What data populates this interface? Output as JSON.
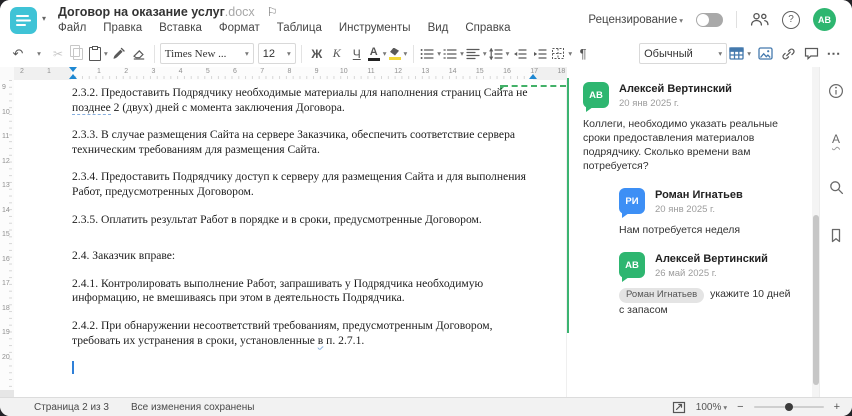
{
  "window": {
    "title": "Договор на оказание услуг",
    "ext": ".docx"
  },
  "menu": {
    "items": [
      "Файл",
      "Правка",
      "Вставка",
      "Формат",
      "Таблица",
      "Инструменты",
      "Вид",
      "Справка"
    ]
  },
  "topbar": {
    "review_label": "Рецензирование",
    "avatar_initials": "АВ"
  },
  "toolbar": {
    "font_name": "Times New ...",
    "font_size": "12",
    "bold_label": "Ж",
    "italic_label": "К",
    "underline_label": "Ч",
    "font_color_letter": "А",
    "style_name": "Обычный"
  },
  "icons": {
    "undo": "↶",
    "caret": "▾",
    "cut": "✂",
    "pilcrow": "¶",
    "more": "⋯",
    "flag": "⚐",
    "question": "?",
    "minus": "−",
    "plus": "+",
    "spell_letter": "А"
  },
  "ruler": {
    "h_left": [
      "2",
      "1"
    ],
    "h_numbers": [
      "1",
      "2",
      "3",
      "4",
      "5",
      "6",
      "7",
      "8",
      "9",
      "10",
      "11",
      "12",
      "13",
      "14",
      "15",
      "16",
      "17",
      "18"
    ],
    "v_numbers": [
      "9",
      "10",
      "11",
      "12",
      "13",
      "14",
      "15",
      "16",
      "17",
      "18",
      "19",
      "20"
    ]
  },
  "document": {
    "paragraphs": [
      {
        "segments": [
          {
            "t": "2.3.2. Предоставить Подрядчику необходимые материалы для наполнения страниц Сайта не "
          },
          {
            "t": "позднее",
            "u": "dashed"
          },
          {
            "t": " 2 (двух) дней с момента заключения Договора."
          }
        ]
      },
      {
        "segments": [
          {
            "t": "2.3.3. В случае размещения Сайта на сервере Заказчика, обеспечить соответствие сервера техническим требованиям для размещения Сайта."
          }
        ]
      },
      {
        "segments": [
          {
            "t": "2.3.4. Предоставить Подрядчику доступ к серверу для размещения Сайта и для выполнения Работ, предусмотренных Договором."
          }
        ]
      },
      {
        "segments": [
          {
            "t": "2.3.5. Оплатить результат Работ в порядке и в сроки, предусмотренные Договором."
          }
        ]
      },
      {
        "gap": true,
        "segments": [
          {
            "t": "2.4. Заказчик вправе:"
          }
        ]
      },
      {
        "segments": [
          {
            "t": "2.4.1. Контролировать выполнение Работ, запрашивать у Подрядчика необходимую информацию, не вмешиваясь при этом в деятельность Подрядчика."
          }
        ]
      },
      {
        "segments": [
          {
            "t": "2.4.2. При обнаружении несоответствий требованиям, предусмотренным Договором, требовать их устранения в сроки, установленные "
          },
          {
            "t": "в",
            "u": "wavy"
          },
          {
            "t": " п. 2.7.1."
          }
        ]
      }
    ]
  },
  "comments": {
    "thread": [
      {
        "initials": "АВ",
        "name": "Алексей Вертинский",
        "date": "20 янв 2025 г.",
        "text": "Коллеги, необходимо указать реальные сроки предоставления материалов подрядчику. Сколько времени вам потребуется?",
        "avatar_color": "#2eb670",
        "is_reply": false
      },
      {
        "initials": "РИ",
        "name": "Роман Игнатьев",
        "date": "20 янв 2025 г.",
        "text": "Нам потребуется неделя",
        "avatar_color": "#3d8ff5",
        "is_reply": true
      },
      {
        "initials": "АВ",
        "name": "Алексей Вертинский",
        "date": "26 май 2025 г.",
        "mention": "Роман Игнатьев",
        "text": " укажите 10 дней с запасом",
        "avatar_color": "#2eb670",
        "is_reply": true
      }
    ]
  },
  "status": {
    "page_label": "Страница 2 из 3",
    "saved_label": "Все изменения сохранены",
    "zoom_value": "100%"
  },
  "colors": {
    "accent_teal": "#3fc3d6",
    "green": "#2eb670",
    "blue": "#3d8ff5",
    "toolbar_blue": "#4479ad",
    "marker_blue": "#1e88d2",
    "comment_border": "#3cb471"
  }
}
